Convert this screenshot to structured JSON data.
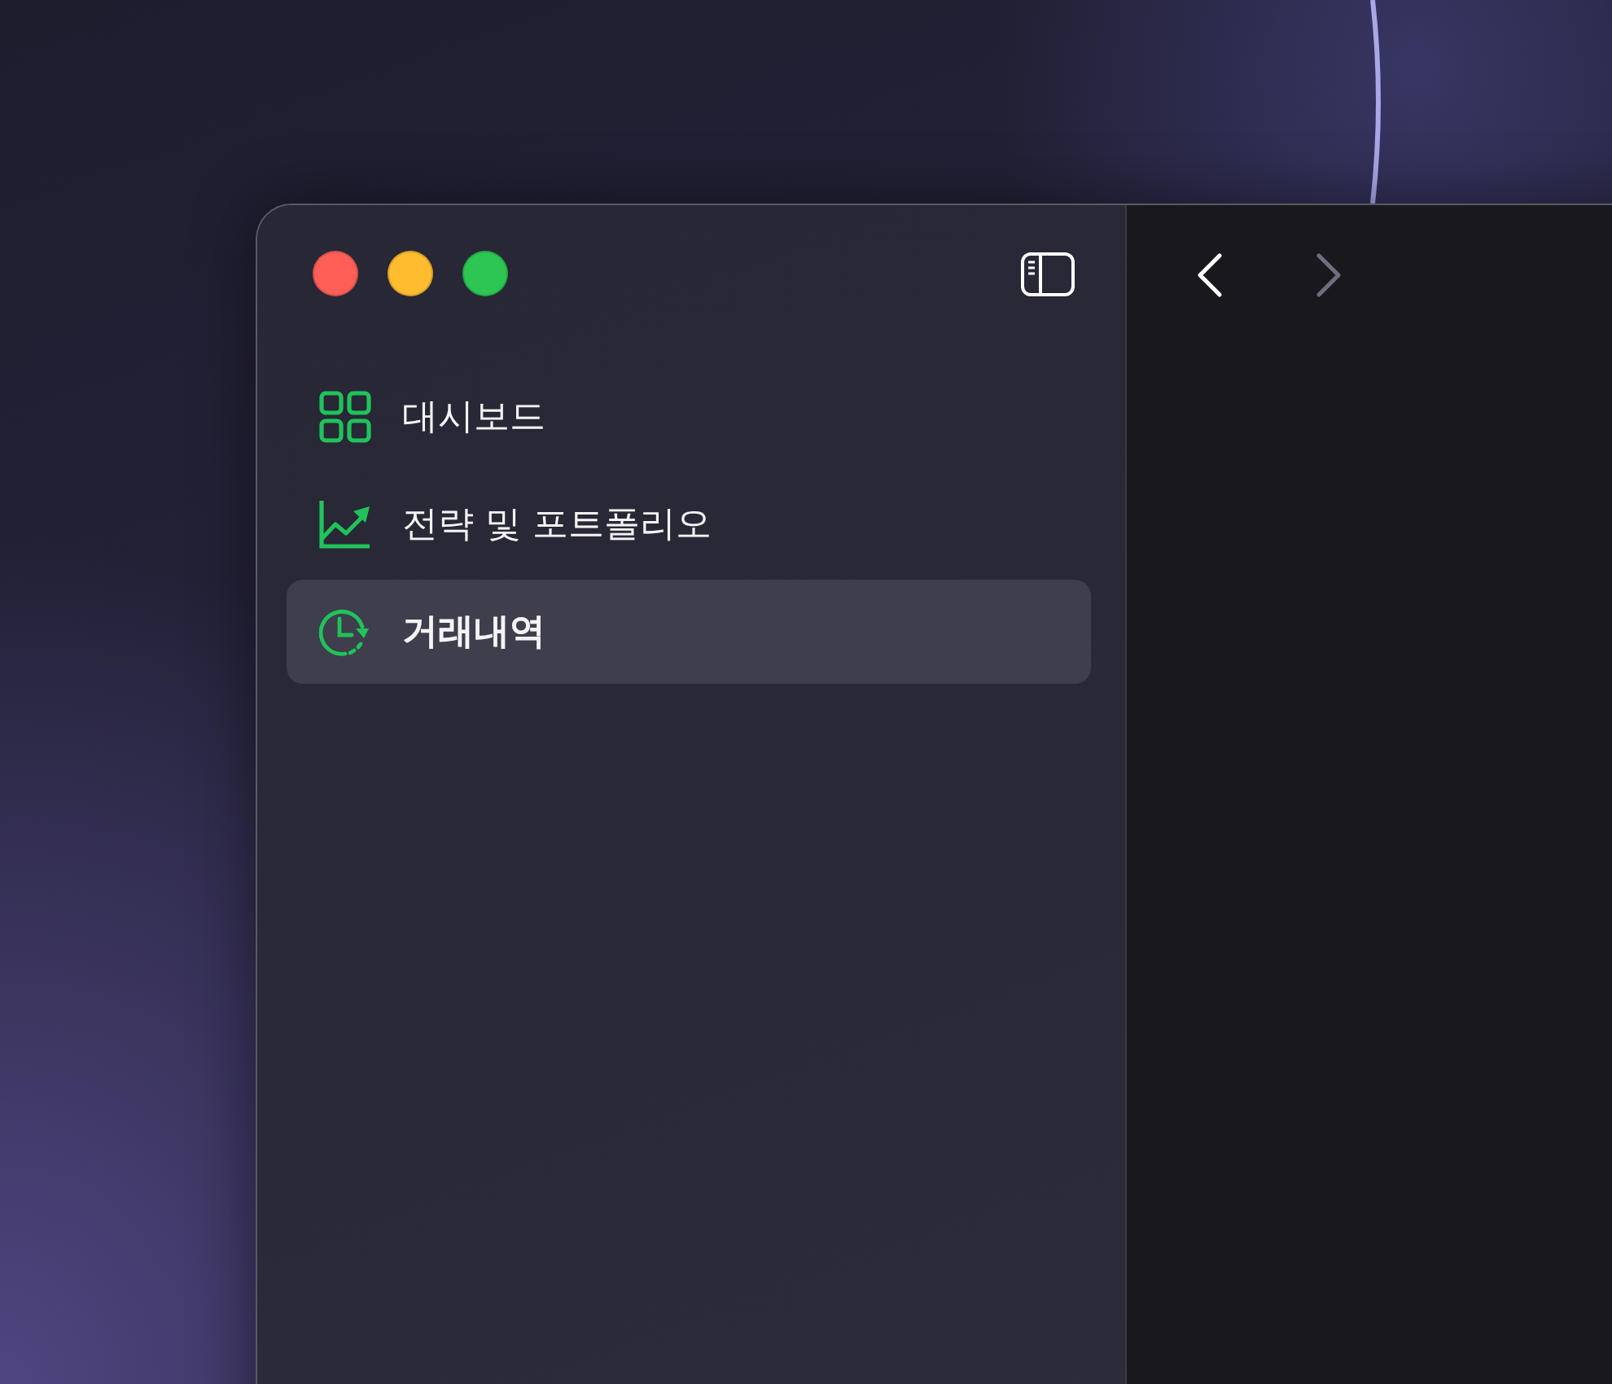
{
  "navigation": {
    "back": {
      "disabled": false
    },
    "forward": {
      "disabled": true
    }
  },
  "sidebar": {
    "items": [
      {
        "kind": "dashboard",
        "label": "대시보드",
        "selected": false
      },
      {
        "kind": "strategy",
        "label": "전략 및 포트폴리오",
        "selected": false
      },
      {
        "kind": "history",
        "label": "거래내역",
        "selected": true
      }
    ]
  }
}
